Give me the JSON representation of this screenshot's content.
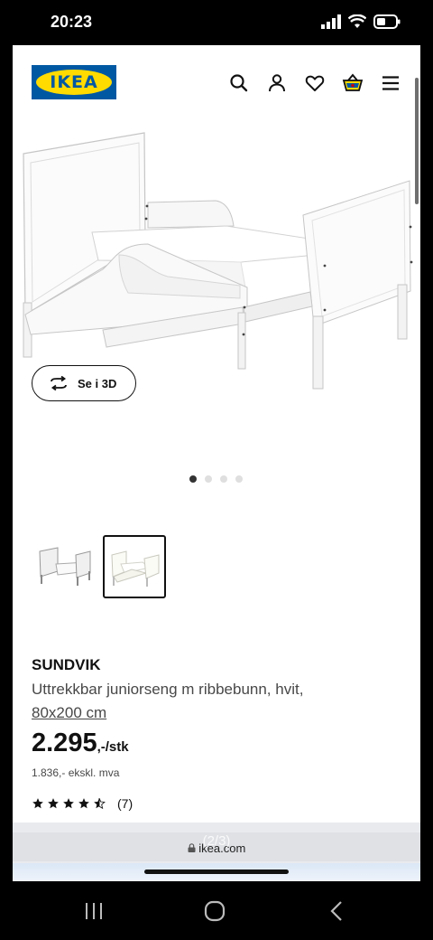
{
  "status_bar": {
    "time": "20:23"
  },
  "header": {
    "logo_text": "IKEA",
    "brand_color": "#0058a3",
    "logo_yellow": "#ffdb00",
    "icons": [
      "search-icon",
      "profile-icon",
      "heart-icon",
      "basket-icon",
      "menu-icon"
    ]
  },
  "hero": {
    "view_3d_label": "Se i 3D",
    "carousel": {
      "count": 4,
      "active": 1
    }
  },
  "thumbnails": {
    "count": 2,
    "selected": 2
  },
  "product": {
    "brand": "SUNDVIK",
    "description": "Uttrekkbar juniorseng m ribbebunn, hvit,",
    "size_link": "80x200 cm",
    "price": "2.295",
    "price_unit": ",-/stk",
    "price_ex_vat": "1.836,- ekskl. mva",
    "rating": {
      "stars": 4.5,
      "max": 5,
      "count": "(7)"
    }
  },
  "browser": {
    "url": "ikea.com",
    "page_counter": "(2/3)"
  },
  "nav": {
    "icons": [
      "recent-apps-icon",
      "home-icon",
      "back-icon"
    ]
  }
}
